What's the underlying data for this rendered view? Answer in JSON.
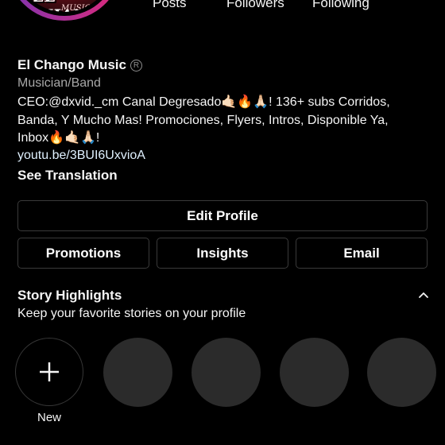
{
  "profile": {
    "name": "El Chango Music",
    "category": "Musician/Band",
    "bio_lines": [
      "CEO:@dxvid._cm Canal Degresado🤙🏻🔥🙏🏻! 136+ subs Corridos,",
      "Banda, Y Mucho Mas! Promociones, Flyers, Intros, Disponible Ya,",
      "Inbox🔥🤙🏻🙏🏻!"
    ],
    "link": "youtu.be/3BUI6UxvioA",
    "see_translation": "See Translation",
    "avatar_text": "EL CHANGO",
    "avatar_subtext": "MUSIC"
  },
  "stats": {
    "posts_label": "Posts",
    "followers_label": "Followers",
    "following_label": "Following"
  },
  "buttons": {
    "edit_profile": "Edit Profile",
    "promotions": "Promotions",
    "insights": "Insights",
    "email": "Email"
  },
  "highlights": {
    "title": "Story Highlights",
    "subtitle": "Keep your favorite stories on your profile",
    "new_label": "New",
    "icons": {
      "collapse": "chevron-up-icon",
      "add": "plus-icon",
      "verified": "registered-icon"
    }
  },
  "colors": {
    "background": "#000000",
    "button_border": "#3a3a3a",
    "secondary_text": "#a8a8a8",
    "placeholder_circle": "#2b2b2b",
    "link": "#e0f1ff"
  }
}
